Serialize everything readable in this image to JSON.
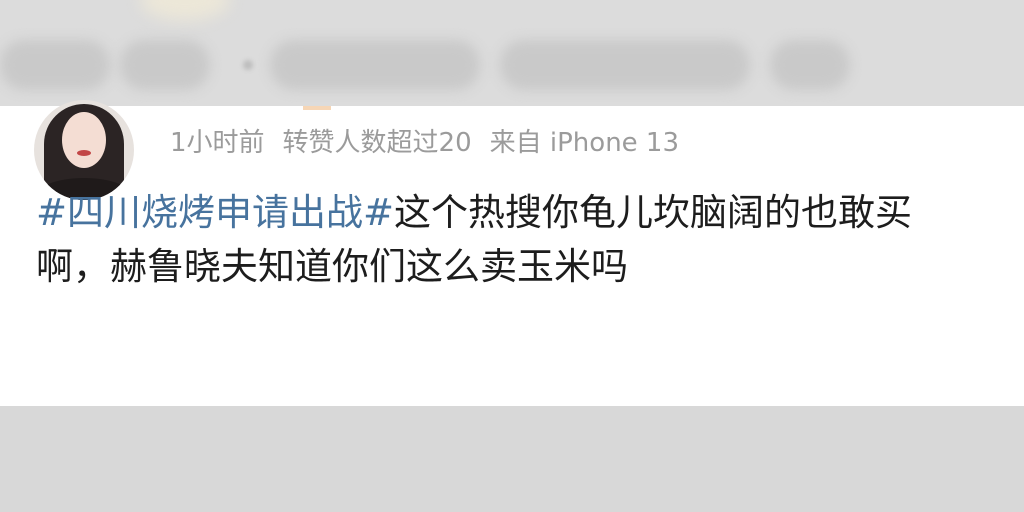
{
  "post": {
    "meta": {
      "time": "1小时前",
      "reposts": "转赞人数超过20",
      "source": "来自 iPhone 13"
    },
    "hashtag": "#四川烧烤申请出战#",
    "line1_text": "这个热搜你龟儿坎脑阔的也敢买",
    "line2_text": "啊，赫鲁晓夫知道你们这么卖玉米吗"
  },
  "colors": {
    "hashtag": "#47739e",
    "meta": "#9b9b9b",
    "text": "#1d1d1d",
    "background": "#d9d9d9",
    "card": "#ffffff"
  },
  "icons": {
    "avatar": "user-avatar-photo"
  }
}
